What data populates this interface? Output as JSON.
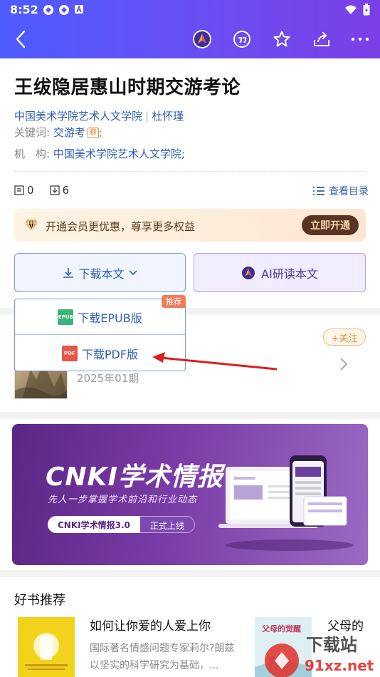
{
  "status_bar": {
    "time": "8:52"
  },
  "paper": {
    "title": "王绂隐居惠山时期交游考论",
    "institution_author": "中国美术学院艺术人文学院",
    "author": "杜怀瑾",
    "keywords_label": "关键词:",
    "keyword": "交游考",
    "keyword_badge": "释",
    "keyword_suffix": ";",
    "institution_label": "机 构:",
    "institution": "中国美术学院艺术人文学院;"
  },
  "stats": {
    "citations": "0",
    "downloads": "6",
    "toc_label": "查看目录"
  },
  "vip": {
    "text": "开通会员更优惠，尊享更多权益",
    "button": "立即开通"
  },
  "actions": {
    "download_label": "下载本文",
    "ai_label": "AI研读本文"
  },
  "dropdown": {
    "recommend_tag": "推荐",
    "epub_label": "下载EPUB版",
    "epub_icon": "EPUB",
    "pdf_label": "下载PDF版",
    "pdf_icon": "PDF"
  },
  "journal": {
    "follow_label": "+关注",
    "date": "2025年01期"
  },
  "promo": {
    "title": "CNKI学术情报",
    "subtitle": "先人一步掌握学术前沿和行业动态",
    "pill_a": "CNKI学术情报3.0",
    "pill_b": "正式上线"
  },
  "recommend": {
    "section_title": "好书推荐",
    "book1_title": "如何让你爱的人爱上你",
    "book1_desc": "国际著名情感问题专家莉尔?朗兹以坚实的科学研究为基础，...",
    "book2_title": "父母的",
    "book2_cover_text": "父母的觉醒"
  },
  "watermark": {
    "text1": "下载站",
    "text2": "91xz.net"
  },
  "colors": {
    "accent": "#2f5fb3",
    "appbar_start": "#4d5cff",
    "appbar_end": "#7a3fe6",
    "annotation_arrow": "#d92020"
  }
}
